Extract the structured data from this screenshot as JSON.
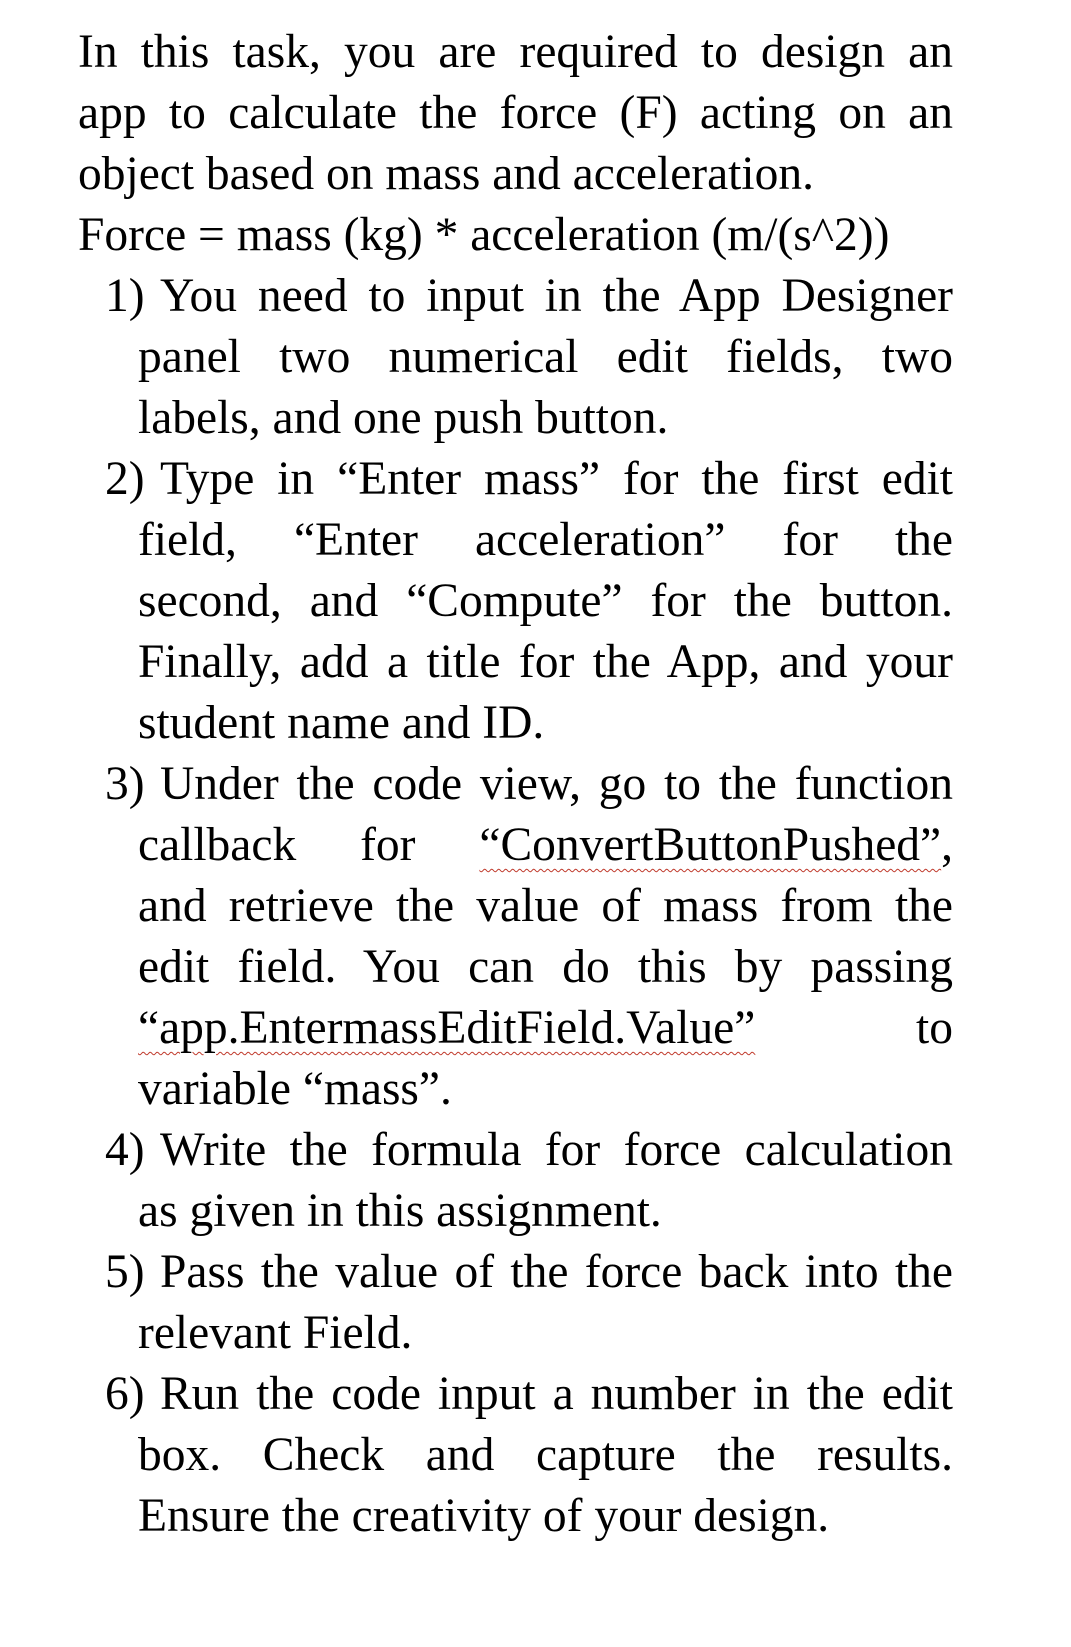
{
  "intro": {
    "lines": [
      "In this task, you are required to design an",
      "app to calculate the force (F) acting on an",
      "object based on mass and acceleration.",
      "Force = mass (kg) * acceleration (m/(s^2))"
    ]
  },
  "steps": [
    {
      "number": "1)",
      "lines": [
        "You need to input in the App Designer",
        "panel two numerical edit fields, two",
        "labels, and one push button."
      ]
    },
    {
      "number": "2)",
      "lines": [
        "Type in “Enter mass” for the first edit",
        "field, “Enter acceleration” for the",
        "second, and “Compute” for the button.",
        "Finally, add a title for the App, and your",
        "student name and ID."
      ]
    },
    {
      "number": "3)",
      "line1": "Under the code view, go to the function",
      "line2_pre": "callback for ",
      "line2_code": "“ConvertButtonPushed”",
      "line2_post": ",",
      "line3": "and retrieve the value of mass from the",
      "line4": "edit field. You can do this by passing",
      "line5_code": "“app.EntermassEditField.Value”",
      "line5_post": "to",
      "line6": "variable “mass”."
    },
    {
      "number": "4)",
      "lines": [
        "Write the formula for force calculation",
        "as given in this assignment."
      ]
    },
    {
      "number": "5)",
      "lines": [
        "Pass the value of the force back into the",
        "relevant Field."
      ]
    },
    {
      "number": "6)",
      "lines": [
        "Run the code input a number in the edit",
        "box. Check and capture the results.",
        "Ensure the creativity of your design."
      ]
    }
  ],
  "colors": {
    "text": "#000000",
    "spellcheck_underline": "#c0392b",
    "background": "#ffffff"
  }
}
